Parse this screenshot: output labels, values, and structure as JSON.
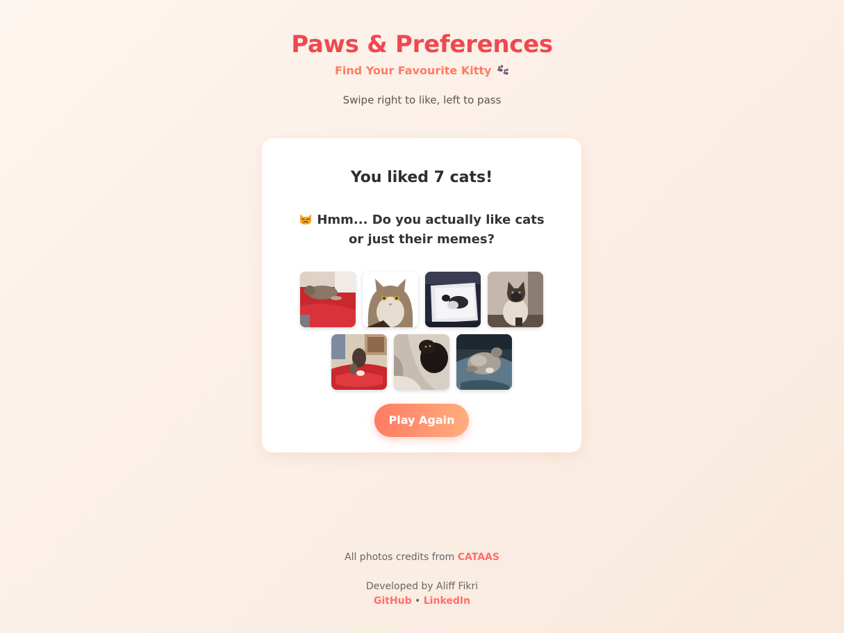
{
  "header": {
    "title": "Paws & Preferences",
    "subtitle": "Find Your Favourite Kitty",
    "subtitle_icon": "paw-prints-icon",
    "instructions": "Swipe right to like, left to pass"
  },
  "result": {
    "heading": "You liked 7 cats!",
    "emoji_icon": "grumpy-cat-emoji-icon",
    "message": "Hmm... Do you actually like cats or just their memes?",
    "liked_cats": [
      {
        "description": "cat lying on red blanket"
      },
      {
        "description": "fluffy long-haired cat"
      },
      {
        "description": "black and white cat on white cushion"
      },
      {
        "description": "siamese cat sitting"
      },
      {
        "description": "cat on red cushion"
      },
      {
        "description": "black cat on blanket"
      },
      {
        "description": "grey cat lying on blanket"
      }
    ],
    "play_again_label": "Play Again"
  },
  "footer": {
    "credits_prefix": "All photos credits from",
    "credits_link": "CATAAS",
    "developer": "Developed by Aliff Fikri",
    "github_link": "GitHub",
    "separator": "•",
    "linkedin_link": "LinkedIn"
  },
  "colors": {
    "title": "#f0484f",
    "subtitle": "#ff7b63",
    "button_start": "#ff7b63",
    "button_end": "#ffae7f",
    "link": "#ff6e6e"
  }
}
